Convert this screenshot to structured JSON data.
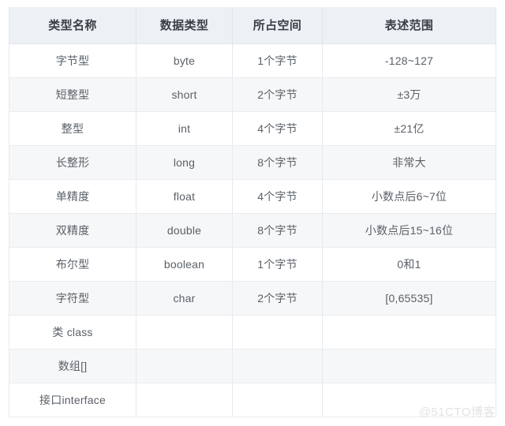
{
  "table": {
    "columns": [
      "类型名称",
      "数据类型",
      "所占空间",
      "表述范围"
    ],
    "rows": [
      {
        "name": "字节型",
        "datatype": "byte",
        "size": "1个字节",
        "range": "-128~127"
      },
      {
        "name": "短整型",
        "datatype": "short",
        "size": "2个字节",
        "range": "±3万"
      },
      {
        "name": "整型",
        "datatype": "int",
        "size": "4个字节",
        "range": "±21亿"
      },
      {
        "name": "长整形",
        "datatype": "long",
        "size": "8个字节",
        "range": "非常大"
      },
      {
        "name": "单精度",
        "datatype": "float",
        "size": "4个字节",
        "range": "小数点后6~7位"
      },
      {
        "name": "双精度",
        "datatype": "double",
        "size": "8个字节",
        "range": "小数点后15~16位"
      },
      {
        "name": "布尔型",
        "datatype": "boolean",
        "size": "1个字节",
        "range": "0和1"
      },
      {
        "name": "字符型",
        "datatype": "char",
        "size": "2个字节",
        "range": "[0,65535]"
      },
      {
        "name": "类 class",
        "datatype": "",
        "size": "",
        "range": ""
      },
      {
        "name": "数组[]",
        "datatype": "",
        "size": "",
        "range": ""
      },
      {
        "name": "接口interface",
        "datatype": "",
        "size": "",
        "range": ""
      }
    ]
  },
  "watermark": {
    "text": "@51CTO博客"
  },
  "colors": {
    "header_background": "#edf1f5",
    "header_text": "#3a3f45",
    "body_text": "#5a6068",
    "row_alt_background": "#f6f7f8",
    "border": "#e6e9ed",
    "watermark_text": "#e2e3e6"
  }
}
